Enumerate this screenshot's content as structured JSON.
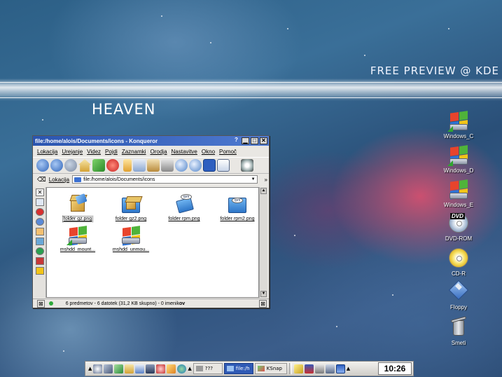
{
  "wallpaper": {
    "banner_top": "FREE PREVIEW @ KDE",
    "banner_bottom": "HEAVEN"
  },
  "desktop_icons": [
    {
      "name": "windows-c",
      "label": "Windows_C",
      "icon": "windows-drive-icon"
    },
    {
      "name": "windows-d",
      "label": "Windows_D",
      "icon": "windows-drive-icon"
    },
    {
      "name": "windows-e",
      "label": "Windows_E",
      "icon": "windows-drive-icon"
    },
    {
      "name": "dvd-rom",
      "label": "DVD-ROM",
      "icon": "dvd-icon"
    },
    {
      "name": "cd-r",
      "label": "CD-R",
      "icon": "cd-icon"
    },
    {
      "name": "floppy",
      "label": "Floppy",
      "icon": "floppy-icon"
    },
    {
      "name": "trash",
      "label": "Smeti",
      "icon": "trash-icon"
    }
  ],
  "window": {
    "title": "file:/home/alois/Documents/icons - Konqueror",
    "help_btn": "?",
    "menu": [
      "Lokacija",
      "Urejanje",
      "Videz",
      "Pojdi",
      "Zaznamki",
      "Orodja",
      "Nastavitve",
      "Okno",
      "Pomoč"
    ],
    "location_label": "Lokacija",
    "location_value": "file:/home/alois/Documents/icons",
    "files": [
      {
        "name": "folder gz.png",
        "icon": "package-box-icon",
        "selected": true
      },
      {
        "name": "folder gz2.png",
        "icon": "package-folder-icon",
        "selected": false
      },
      {
        "name": "folder rpm.png",
        "icon": "rpm-icon",
        "selected": false
      },
      {
        "name": "folder rpm2.png",
        "icon": "rpm-folder-icon",
        "selected": false
      },
      {
        "name": "mshdd_mount...",
        "icon": "windows-drive-icon",
        "selected": false
      },
      {
        "name": "mshdd_unmou...",
        "icon": "windows-drive-icon",
        "selected": false
      }
    ],
    "status_text": "6 predmetov - 6 datotek (31,2 KB skupno) - 0 imenik",
    "status_bold": "ov"
  },
  "taskbar": {
    "tasks": [
      {
        "label": "???",
        "active": false
      },
      {
        "label": "file:/h",
        "active": true
      },
      {
        "label": "KSnap",
        "active": false
      }
    ],
    "clock": "10:26"
  }
}
